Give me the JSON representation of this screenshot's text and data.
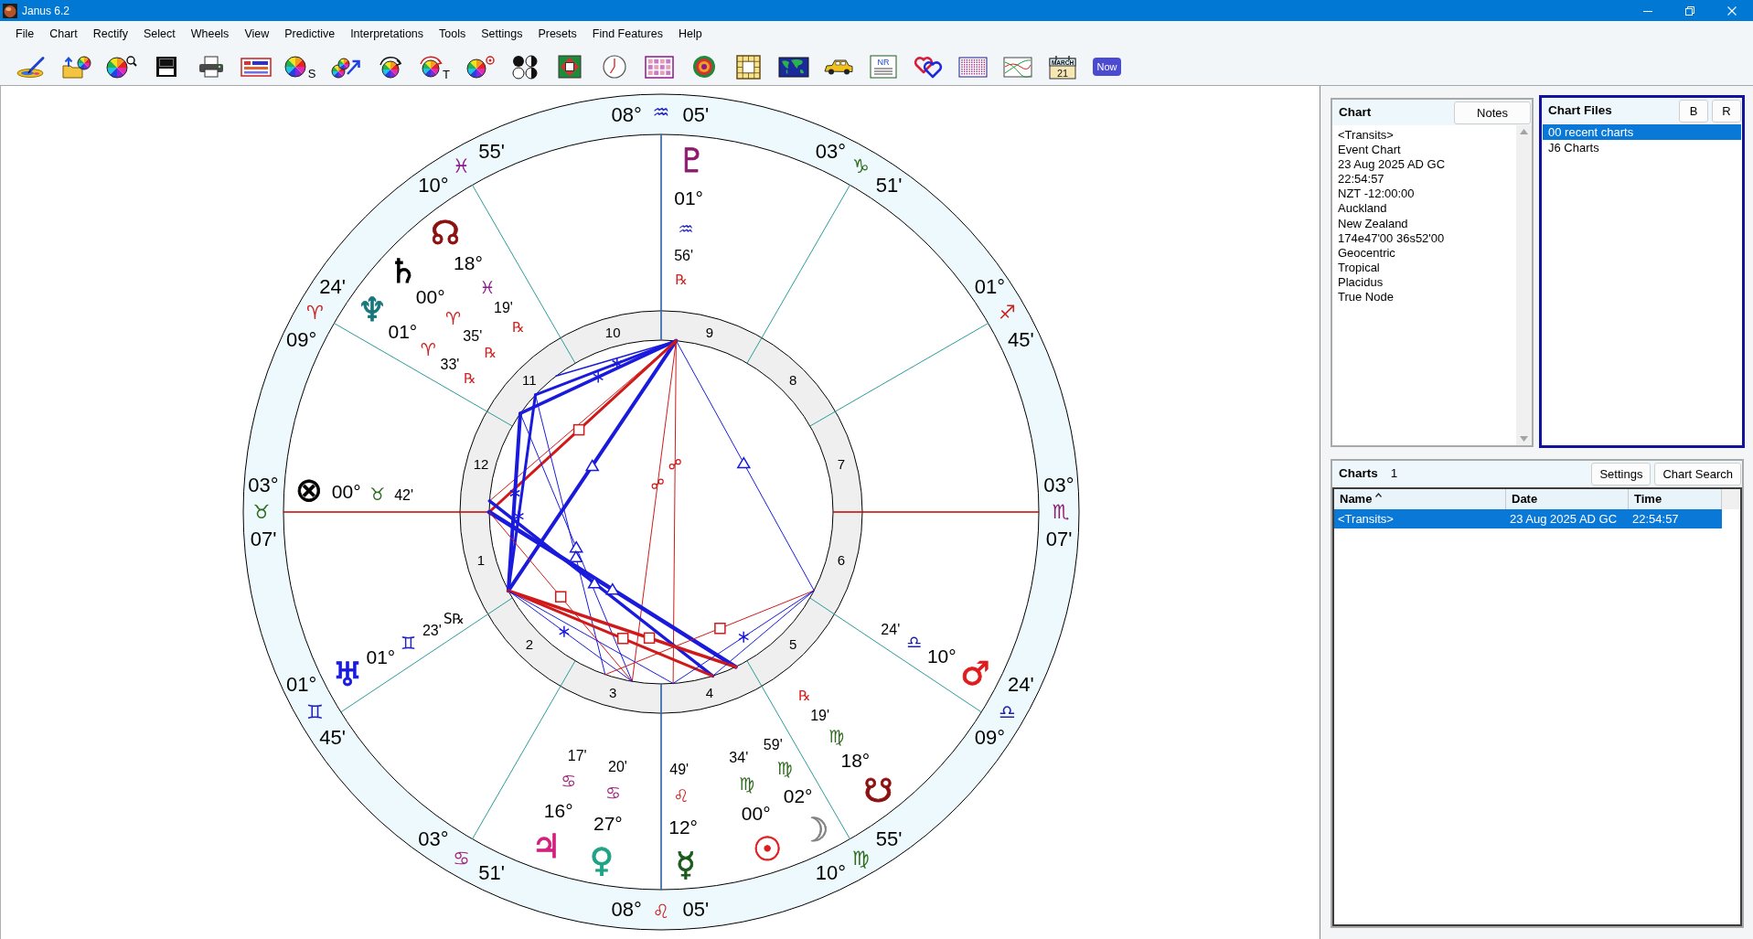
{
  "window": {
    "title": "Janus 6.2"
  },
  "menu": [
    "File",
    "Chart",
    "Rectify",
    "Select",
    "Wheels",
    "View",
    "Predictive",
    "Interpretations",
    "Tools",
    "Settings",
    "Presets",
    "Find Features",
    "Help"
  ],
  "toolbar": [
    {
      "kind": "edit"
    },
    {
      "kind": "open"
    },
    {
      "kind": "find"
    },
    {
      "kind": "save"
    },
    {
      "kind": "print"
    },
    {
      "kind": "list"
    },
    {
      "kind": "wheel_letter",
      "letter": "S"
    },
    {
      "kind": "biwheel"
    },
    {
      "kind": "progress"
    },
    {
      "kind": "wheel_arcs",
      "letter": "T"
    },
    {
      "kind": "wheel_target"
    },
    {
      "kind": "dots"
    },
    {
      "kind": "square_pattern"
    },
    {
      "kind": "clock"
    },
    {
      "kind": "number_grid"
    },
    {
      "kind": "rings"
    },
    {
      "kind": "tile_grid"
    },
    {
      "kind": "map"
    },
    {
      "kind": "car"
    },
    {
      "kind": "document",
      "label": "NR"
    },
    {
      "kind": "hearts"
    },
    {
      "kind": "stripes"
    },
    {
      "kind": "graph"
    },
    {
      "kind": "calendar",
      "month": "MARCH",
      "day": "21"
    },
    {
      "kind": "now",
      "label": "Now"
    }
  ],
  "chart_wheel": {
    "cusps": [
      {
        "house": "10",
        "degree": "08°",
        "sign": {
          "symbol": "♒",
          "color": "#1f1fc8"
        },
        "minutes": "05'"
      },
      {
        "house": "11",
        "degree": "10°",
        "sign": {
          "symbol": "♓",
          "color": "#8c1a8c"
        },
        "minutes": "55'"
      },
      {
        "house": "9",
        "degree": "03°",
        "sign": {
          "symbol": "♑",
          "color": "#2f6b1f"
        },
        "minutes": "51'"
      },
      {
        "house": "12",
        "degree": "09°",
        "sign": {
          "symbol": "♈",
          "color": "#cc2222"
        },
        "minutes": "24'"
      },
      {
        "house": "8",
        "degree": "01°",
        "sign": {
          "symbol": "♐",
          "color": "#cc2222"
        },
        "minutes": "45'"
      },
      {
        "house": "1",
        "degree": "03°",
        "sign": {
          "symbol": "♉",
          "color": "#2f6b1f"
        },
        "minutes": "07'"
      },
      {
        "house": "7",
        "degree": "03°",
        "sign": {
          "symbol": "♏",
          "color": "#8c1a6e"
        },
        "minutes": "07'"
      },
      {
        "house": "2",
        "degree": "01°",
        "sign": {
          "symbol": "♊",
          "color": "#1f1fc8"
        },
        "minutes": "45'"
      },
      {
        "house": "6",
        "degree": "09°",
        "sign": {
          "symbol": "♎",
          "color": "#1f1fa8"
        },
        "minutes": "24'"
      },
      {
        "house": "3",
        "degree": "03°",
        "sign": {
          "symbol": "♋",
          "color": "#a3287c"
        },
        "minutes": "51'"
      },
      {
        "house": "5",
        "degree": "10°",
        "sign": {
          "symbol": "♍",
          "color": "#2f6b1f"
        },
        "minutes": "55'"
      },
      {
        "house": "4",
        "degree": "08°",
        "sign": {
          "symbol": "♌",
          "color": "#cc2222"
        },
        "minutes": "05'"
      }
    ],
    "planets": [
      {
        "glyph": "♇",
        "color": "#8c1a6e",
        "degree": "01°",
        "sign": {
          "symbol": "♒",
          "color": "#1f1fc8"
        },
        "minutes": "56'",
        "retrograde": {
          "mark": "℞",
          "color": "#d42020"
        }
      },
      {
        "glyph": "☊",
        "color": "#8b1010",
        "degree": "18°",
        "sign": {
          "symbol": "♓",
          "color": "#8c1a8c"
        },
        "minutes": "19'",
        "retrograde": {
          "mark": "℞",
          "color": "#d42020"
        }
      },
      {
        "glyph": "♄",
        "color": "#000000",
        "degree": "00°",
        "sign": {
          "symbol": "♈",
          "color": "#cc2222"
        },
        "minutes": "35'",
        "retrograde": {
          "mark": "℞",
          "color": "#d42020"
        }
      },
      {
        "glyph": "♆",
        "color": "#17767c",
        "degree": "01°",
        "sign": {
          "symbol": "♈",
          "color": "#cc2222"
        },
        "minutes": "33'",
        "retrograde": {
          "mark": "℞",
          "color": "#d42020"
        }
      },
      {
        "glyph": "⊗",
        "color": "#000000",
        "degree": "00°",
        "sign": {
          "symbol": "♉",
          "color": "#2f6b1f"
        },
        "minutes": "42'"
      },
      {
        "glyph": "♅",
        "color": "#1a1ae0",
        "degree": "01°",
        "sign": {
          "symbol": "♊",
          "color": "#1f1fc8"
        },
        "minutes": "23'",
        "retrograde": {
          "mark": "S℞",
          "color": "#000000"
        }
      },
      {
        "glyph": "♂",
        "color": "#e01c1c",
        "degree": "10°",
        "sign": {
          "symbol": "♎",
          "color": "#1f1fa8"
        },
        "minutes": "24'"
      },
      {
        "glyph": "♃",
        "color": "#d4207c",
        "degree": "16°",
        "sign": {
          "symbol": "♋",
          "color": "#a3287c"
        },
        "minutes": "17'"
      },
      {
        "glyph": "♀",
        "color": "#1fa385",
        "degree": "27°",
        "sign": {
          "symbol": "♋",
          "color": "#a3287c"
        },
        "minutes": "20'"
      },
      {
        "glyph": "☿",
        "color": "#1a5a1a",
        "degree": "12°",
        "sign": {
          "symbol": "♌",
          "color": "#cc2222"
        },
        "minutes": "49'"
      },
      {
        "glyph": "☉",
        "color": "#dd1c1c",
        "degree": "00°",
        "sign": {
          "symbol": "♍",
          "color": "#2f6b1f"
        },
        "minutes": "34'"
      },
      {
        "glyph": "☽",
        "color": "#808080",
        "degree": "02°",
        "sign": {
          "symbol": "♍",
          "color": "#2f6b1f"
        },
        "minutes": "59'"
      },
      {
        "glyph": "☋",
        "color": "#8b1010",
        "degree": "18°",
        "sign": {
          "symbol": "♍",
          "color": "#2f6b1f"
        },
        "minutes": "19'",
        "retrograde": {
          "mark": "℞",
          "color": "#d42020"
        }
      }
    ]
  },
  "chart_panel": {
    "title": "Chart",
    "button": "Notes",
    "lines": [
      "<Transits>",
      "Event Chart",
      "23 Aug 2025 AD GC",
      "22:54:57",
      "NZT -12:00:00",
      "Auckland",
      "New Zealand",
      "174e47'00 36s52'00",
      "Geocentric",
      "Tropical",
      "Placidus",
      "True Node"
    ]
  },
  "chart_files": {
    "title": "Chart Files",
    "buttons": [
      "B",
      "R"
    ],
    "items": [
      {
        "label": "00 recent charts",
        "selected": true
      },
      {
        "label": "J6 Charts",
        "selected": false
      }
    ]
  },
  "charts": {
    "title": "Charts",
    "count": "1",
    "buttons": [
      "Settings",
      "Chart Search"
    ],
    "columns": [
      {
        "label": "Name",
        "sorted": true
      },
      {
        "label": "Date",
        "sorted": false
      },
      {
        "label": "Time",
        "sorted": false
      }
    ],
    "rows": [
      {
        "cells": [
          "<Transits>",
          "23 Aug 2025 AD GC",
          "22:54:57"
        ],
        "selected": true
      }
    ]
  }
}
